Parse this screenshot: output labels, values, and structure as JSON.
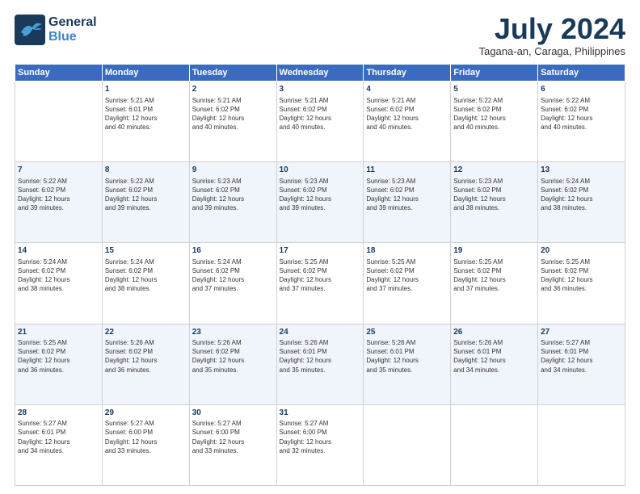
{
  "header": {
    "logo_line1": "General",
    "logo_line2": "Blue",
    "month": "July 2024",
    "location": "Tagana-an, Caraga, Philippines"
  },
  "days_of_week": [
    "Sunday",
    "Monday",
    "Tuesday",
    "Wednesday",
    "Thursday",
    "Friday",
    "Saturday"
  ],
  "weeks": [
    [
      {
        "day": "",
        "info": ""
      },
      {
        "day": "1",
        "info": "Sunrise: 5:21 AM\nSunset: 6:01 PM\nDaylight: 12 hours\nand 40 minutes."
      },
      {
        "day": "2",
        "info": "Sunrise: 5:21 AM\nSunset: 6:02 PM\nDaylight: 12 hours\nand 40 minutes."
      },
      {
        "day": "3",
        "info": "Sunrise: 5:21 AM\nSunset: 6:02 PM\nDaylight: 12 hours\nand 40 minutes."
      },
      {
        "day": "4",
        "info": "Sunrise: 5:21 AM\nSunset: 6:02 PM\nDaylight: 12 hours\nand 40 minutes."
      },
      {
        "day": "5",
        "info": "Sunrise: 5:22 AM\nSunset: 6:02 PM\nDaylight: 12 hours\nand 40 minutes."
      },
      {
        "day": "6",
        "info": "Sunrise: 5:22 AM\nSunset: 6:02 PM\nDaylight: 12 hours\nand 40 minutes."
      }
    ],
    [
      {
        "day": "7",
        "info": "Sunrise: 5:22 AM\nSunset: 6:02 PM\nDaylight: 12 hours\nand 39 minutes."
      },
      {
        "day": "8",
        "info": "Sunrise: 5:22 AM\nSunset: 6:02 PM\nDaylight: 12 hours\nand 39 minutes."
      },
      {
        "day": "9",
        "info": "Sunrise: 5:23 AM\nSunset: 6:02 PM\nDaylight: 12 hours\nand 39 minutes."
      },
      {
        "day": "10",
        "info": "Sunrise: 5:23 AM\nSunset: 6:02 PM\nDaylight: 12 hours\nand 39 minutes."
      },
      {
        "day": "11",
        "info": "Sunrise: 5:23 AM\nSunset: 6:02 PM\nDaylight: 12 hours\nand 39 minutes."
      },
      {
        "day": "12",
        "info": "Sunrise: 5:23 AM\nSunset: 6:02 PM\nDaylight: 12 hours\nand 38 minutes."
      },
      {
        "day": "13",
        "info": "Sunrise: 5:24 AM\nSunset: 6:02 PM\nDaylight: 12 hours\nand 38 minutes."
      }
    ],
    [
      {
        "day": "14",
        "info": "Sunrise: 5:24 AM\nSunset: 6:02 PM\nDaylight: 12 hours\nand 38 minutes."
      },
      {
        "day": "15",
        "info": "Sunrise: 5:24 AM\nSunset: 6:02 PM\nDaylight: 12 hours\nand 38 minutes."
      },
      {
        "day": "16",
        "info": "Sunrise: 5:24 AM\nSunset: 6:02 PM\nDaylight: 12 hours\nand 37 minutes."
      },
      {
        "day": "17",
        "info": "Sunrise: 5:25 AM\nSunset: 6:02 PM\nDaylight: 12 hours\nand 37 minutes."
      },
      {
        "day": "18",
        "info": "Sunrise: 5:25 AM\nSunset: 6:02 PM\nDaylight: 12 hours\nand 37 minutes."
      },
      {
        "day": "19",
        "info": "Sunrise: 5:25 AM\nSunset: 6:02 PM\nDaylight: 12 hours\nand 37 minutes."
      },
      {
        "day": "20",
        "info": "Sunrise: 5:25 AM\nSunset: 6:02 PM\nDaylight: 12 hours\nand 36 minutes."
      }
    ],
    [
      {
        "day": "21",
        "info": "Sunrise: 5:25 AM\nSunset: 6:02 PM\nDaylight: 12 hours\nand 36 minutes."
      },
      {
        "day": "22",
        "info": "Sunrise: 5:26 AM\nSunset: 6:02 PM\nDaylight: 12 hours\nand 36 minutes."
      },
      {
        "day": "23",
        "info": "Sunrise: 5:26 AM\nSunset: 6:02 PM\nDaylight: 12 hours\nand 35 minutes."
      },
      {
        "day": "24",
        "info": "Sunrise: 5:26 AM\nSunset: 6:01 PM\nDaylight: 12 hours\nand 35 minutes."
      },
      {
        "day": "25",
        "info": "Sunrise: 5:26 AM\nSunset: 6:01 PM\nDaylight: 12 hours\nand 35 minutes."
      },
      {
        "day": "26",
        "info": "Sunrise: 5:26 AM\nSunset: 6:01 PM\nDaylight: 12 hours\nand 34 minutes."
      },
      {
        "day": "27",
        "info": "Sunrise: 5:27 AM\nSunset: 6:01 PM\nDaylight: 12 hours\nand 34 minutes."
      }
    ],
    [
      {
        "day": "28",
        "info": "Sunrise: 5:27 AM\nSunset: 6:01 PM\nDaylight: 12 hours\nand 34 minutes."
      },
      {
        "day": "29",
        "info": "Sunrise: 5:27 AM\nSunset: 6:00 PM\nDaylight: 12 hours\nand 33 minutes."
      },
      {
        "day": "30",
        "info": "Sunrise: 5:27 AM\nSunset: 6:00 PM\nDaylight: 12 hours\nand 33 minutes."
      },
      {
        "day": "31",
        "info": "Sunrise: 5:27 AM\nSunset: 6:00 PM\nDaylight: 12 hours\nand 32 minutes."
      },
      {
        "day": "",
        "info": ""
      },
      {
        "day": "",
        "info": ""
      },
      {
        "day": "",
        "info": ""
      }
    ]
  ]
}
